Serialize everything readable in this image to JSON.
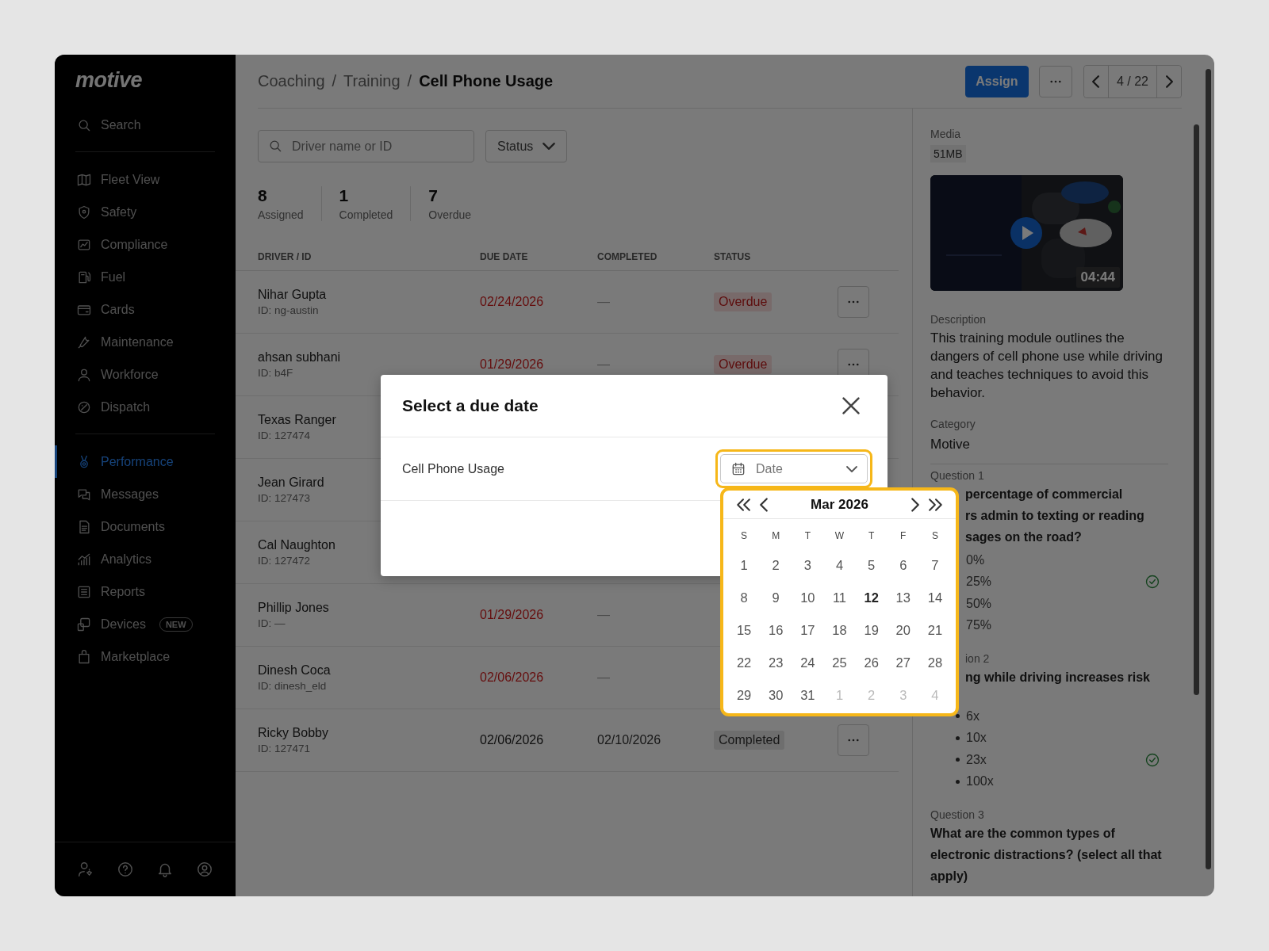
{
  "logo": "motive",
  "sidebar": {
    "search": "Search",
    "groups": [
      [
        {
          "label": "Fleet View",
          "selected": false
        },
        {
          "label": "Safety",
          "selected": false
        },
        {
          "label": "Compliance",
          "selected": false
        },
        {
          "label": "Fuel",
          "selected": false
        },
        {
          "label": "Cards",
          "selected": false
        },
        {
          "label": "Maintenance",
          "selected": false
        },
        {
          "label": "Workforce",
          "selected": false
        },
        {
          "label": "Dispatch",
          "selected": false
        }
      ],
      [
        {
          "label": "Performance",
          "selected": true
        },
        {
          "label": "Messages",
          "selected": false
        },
        {
          "label": "Documents",
          "selected": false
        },
        {
          "label": "Analytics",
          "selected": false
        },
        {
          "label": "Reports",
          "selected": false
        },
        {
          "label": "Devices",
          "selected": false,
          "badge": "NEW"
        },
        {
          "label": "Marketplace",
          "selected": false
        }
      ]
    ]
  },
  "breadcrumb": [
    {
      "label": "Coaching",
      "kind": "link"
    },
    {
      "label": "/",
      "kind": "separator"
    },
    {
      "label": "Training",
      "kind": "link"
    },
    {
      "label": "/",
      "kind": "separator"
    },
    {
      "label": "Cell Phone Usage",
      "kind": "current"
    }
  ],
  "header_actions": {
    "assign": "Assign",
    "pager": "4 / 22"
  },
  "filters": {
    "search_placeholder": "Driver name or ID",
    "status": "Status"
  },
  "stats": [
    {
      "value": "8",
      "label": "Assigned"
    },
    {
      "value": "1",
      "label": "Completed"
    },
    {
      "value": "7",
      "label": "Overdue"
    }
  ],
  "table": {
    "columns": [
      "DRIVER / ID",
      "DUE DATE",
      "COMPLETED",
      "STATUS"
    ],
    "rows": [
      {
        "name": "Nihar Gupta",
        "id": "ID: ng-austin",
        "due_date": "02/24/2026",
        "overdue": true,
        "completed": "—",
        "status": "Overdue",
        "menu": true
      },
      {
        "name": "ahsan subhani",
        "id": "ID: b4F",
        "due_date": "01/29/2026",
        "overdue": true,
        "completed": "—",
        "status": "Overdue",
        "menu": true
      },
      {
        "name": "Texas Ranger",
        "id": "ID: 127474",
        "menu": false
      },
      {
        "name": "Jean Girard",
        "id": "ID: 127473",
        "menu": false
      },
      {
        "name": "Cal Naughton",
        "id": "ID: 127472",
        "menu": false
      },
      {
        "name": "Phillip Jones",
        "id": "ID: —",
        "due_date": "01/29/2026",
        "overdue": true,
        "completed": "—",
        "menu": false
      },
      {
        "name": "Dinesh Coca",
        "id": "ID: dinesh_eld",
        "due_date": "02/06/2026",
        "overdue": true,
        "completed": "—",
        "menu": false
      },
      {
        "name": "Ricky Bobby",
        "id": "ID: 127471",
        "due_date": "02/06/2026",
        "overdue": false,
        "completed": "02/10/2026",
        "status": "Completed",
        "menu": true
      }
    ]
  },
  "details": {
    "media_label": "Media",
    "media_size": "51MB",
    "video": {
      "kind": "picture",
      "duration": "04:44"
    },
    "description_label": "Description",
    "description": "This training module outlines the dangers of cell phone use while driving and teaches techniques to avoid this behavior.",
    "category_label": "Category",
    "category": "Motive",
    "questions": [
      {
        "label": "Question 1",
        "label_cut": false,
        "text_lines": [
          "percentage of commercial",
          "rs admin to texting or reading",
          "sages on the road?"
        ],
        "text_cut": true,
        "bullets": false,
        "options": [
          {
            "text": "0%",
            "correct": false
          },
          {
            "text": "25%",
            "correct": true
          },
          {
            "text": "50%",
            "correct": false
          },
          {
            "text": "75%",
            "correct": false
          }
        ]
      },
      {
        "label": "ion 2",
        "label_cut": true,
        "text_lines": [
          "ng while driving increases risk"
        ],
        "text_cut": true,
        "bullets": true,
        "options": [
          {
            "text": "6x",
            "correct": false
          },
          {
            "text": "10x",
            "correct": false
          },
          {
            "text": "23x",
            "correct": true
          },
          {
            "text": "100x",
            "correct": false
          }
        ]
      },
      {
        "label": "Question 3",
        "text_lines": [
          "What are the common types of",
          "electronic distractions? (select all that",
          "apply)"
        ]
      }
    ]
  },
  "modal": {
    "title": "Select a due date",
    "item": "Cell Phone Usage",
    "date_field": {
      "placeholder": "Date",
      "focused": true
    },
    "calendar": {
      "month": "Mar 2026",
      "weekdays": [
        "S",
        "M",
        "T",
        "W",
        "T",
        "F",
        "S"
      ],
      "days": [
        {
          "day": "1",
          "outside": false,
          "today": false
        },
        {
          "day": "2",
          "outside": false,
          "today": false
        },
        {
          "day": "3",
          "outside": false,
          "today": false
        },
        {
          "day": "4",
          "outside": false,
          "today": false
        },
        {
          "day": "5",
          "outside": false,
          "today": false
        },
        {
          "day": "6",
          "outside": false,
          "today": false
        },
        {
          "day": "7",
          "outside": false,
          "today": false
        },
        {
          "day": "8",
          "outside": false,
          "today": false
        },
        {
          "day": "9",
          "outside": false,
          "today": false
        },
        {
          "day": "10",
          "outside": false,
          "today": false
        },
        {
          "day": "11",
          "outside": false,
          "today": false
        },
        {
          "day": "12",
          "outside": false,
          "today": true
        },
        {
          "day": "13",
          "outside": false,
          "today": false
        },
        {
          "day": "14",
          "outside": false,
          "today": false
        },
        {
          "day": "15",
          "outside": false,
          "today": false
        },
        {
          "day": "16",
          "outside": false,
          "today": false
        },
        {
          "day": "17",
          "outside": false,
          "today": false
        },
        {
          "day": "18",
          "outside": false,
          "today": false
        },
        {
          "day": "19",
          "outside": false,
          "today": false
        },
        {
          "day": "20",
          "outside": false,
          "today": false
        },
        {
          "day": "21",
          "outside": false,
          "today": false
        },
        {
          "day": "22",
          "outside": false,
          "today": false
        },
        {
          "day": "23",
          "outside": false,
          "today": false
        },
        {
          "day": "24",
          "outside": false,
          "today": false
        },
        {
          "day": "25",
          "outside": false,
          "today": false
        },
        {
          "day": "26",
          "outside": false,
          "today": false
        },
        {
          "day": "27",
          "outside": false,
          "today": false
        },
        {
          "day": "28",
          "outside": false,
          "today": false
        },
        {
          "day": "29",
          "outside": false,
          "today": false
        },
        {
          "day": "30",
          "outside": false,
          "today": false
        },
        {
          "day": "31",
          "outside": false,
          "today": false
        },
        {
          "day": "1",
          "outside": true,
          "today": false
        },
        {
          "day": "2",
          "outside": true,
          "today": false
        },
        {
          "day": "3",
          "outside": true,
          "today": false
        },
        {
          "day": "4",
          "outside": true,
          "today": false
        }
      ]
    }
  }
}
